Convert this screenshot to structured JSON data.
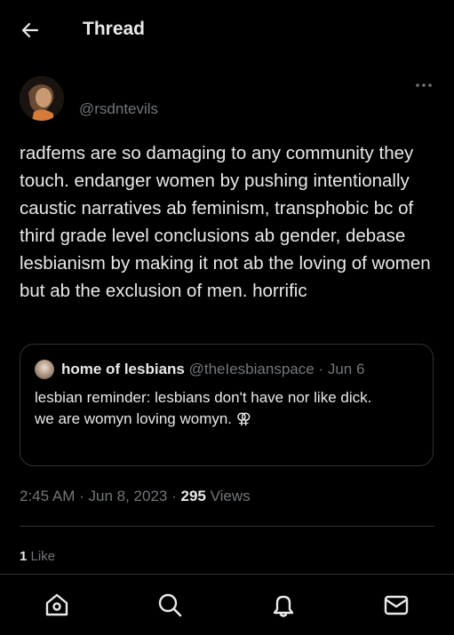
{
  "header": {
    "title": "Thread"
  },
  "author": {
    "handle": "@rsdntevils"
  },
  "tweet": {
    "text": "radfems are so damaging to any community they touch. endanger women by pushing intentionally caustic narratives ab feminism, transphobic bc of third grade level conclusions ab gender, debase lesbianism by making it not ab the loving of women but ab the exclusion of men. horrific"
  },
  "quote": {
    "name": "home of lesbians",
    "handle": "@theIesbianspace",
    "separator": "·",
    "date": "Jun 6",
    "line1": "lesbian reminder: lesbians don't have nor like dick.",
    "line2": "we are womyn loving womyn. ⚢"
  },
  "meta": {
    "time": "2:45 AM",
    "dot1": "·",
    "date": "Jun 8, 2023",
    "dot2": "·",
    "views_count": "295",
    "views_label": "Views"
  },
  "engagement": {
    "likes_count": "1",
    "likes_label": "Like"
  },
  "icons": {
    "back": "arrow-left-icon",
    "more": "more-horizontal-icon",
    "home": "home-icon",
    "search": "search-icon",
    "notifications": "bell-icon",
    "messages": "mail-icon"
  },
  "colors": {
    "background": "#000000",
    "text": "#e7e9ea",
    "muted": "#71767b",
    "border": "#2f3336"
  }
}
